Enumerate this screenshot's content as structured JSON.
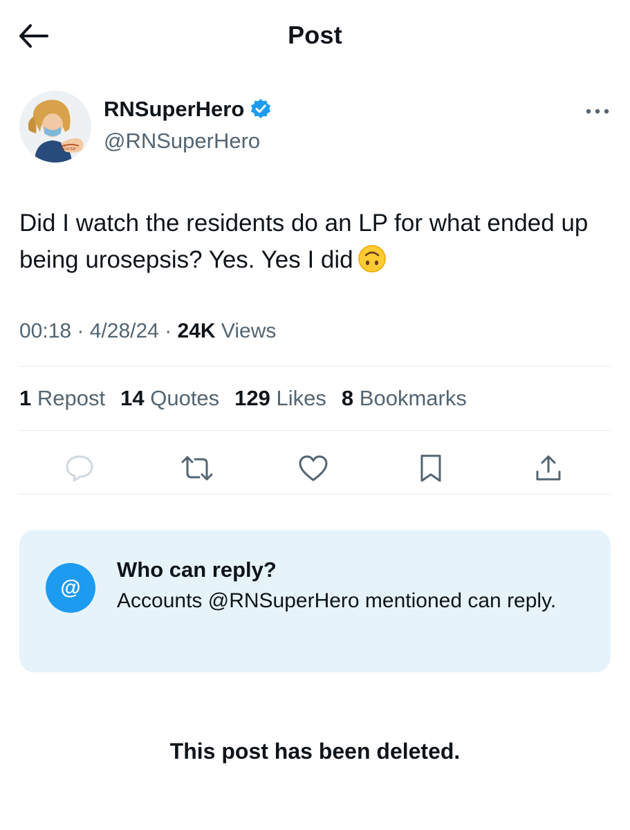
{
  "header": {
    "title": "Post",
    "back_icon": "arrow-left-icon"
  },
  "author": {
    "display_name": "RNSuperHero",
    "handle": "@RNSuperHero",
    "verified": true,
    "verified_color": "#1d9bf0"
  },
  "tweet": {
    "text": "Did I watch the residents do an LP for what ended up being urosepsis? Yes. Yes I did",
    "emoji": "upside-down-face"
  },
  "meta": {
    "time": "00:18",
    "date": "4/28/24",
    "views_count": "24K",
    "views_label": "Views"
  },
  "stats": {
    "reposts_count": "1",
    "reposts_label": "Repost",
    "quotes_count": "14",
    "quotes_label": "Quotes",
    "likes_count": "129",
    "likes_label": "Likes",
    "bookmarks_count": "8",
    "bookmarks_label": "Bookmarks"
  },
  "actions": [
    "reply-icon",
    "repost-icon",
    "like-icon",
    "bookmark-icon",
    "share-icon"
  ],
  "reply_restriction": {
    "icon": "@",
    "title": "Who can reply?",
    "description": "Accounts @RNSuperHero mentioned can reply."
  },
  "status": {
    "deleted_text": "This post has been deleted."
  },
  "colors": {
    "accent": "#1d9bf0",
    "secondary_text": "#536471",
    "reply_box_bg": "#e7f3fb"
  }
}
